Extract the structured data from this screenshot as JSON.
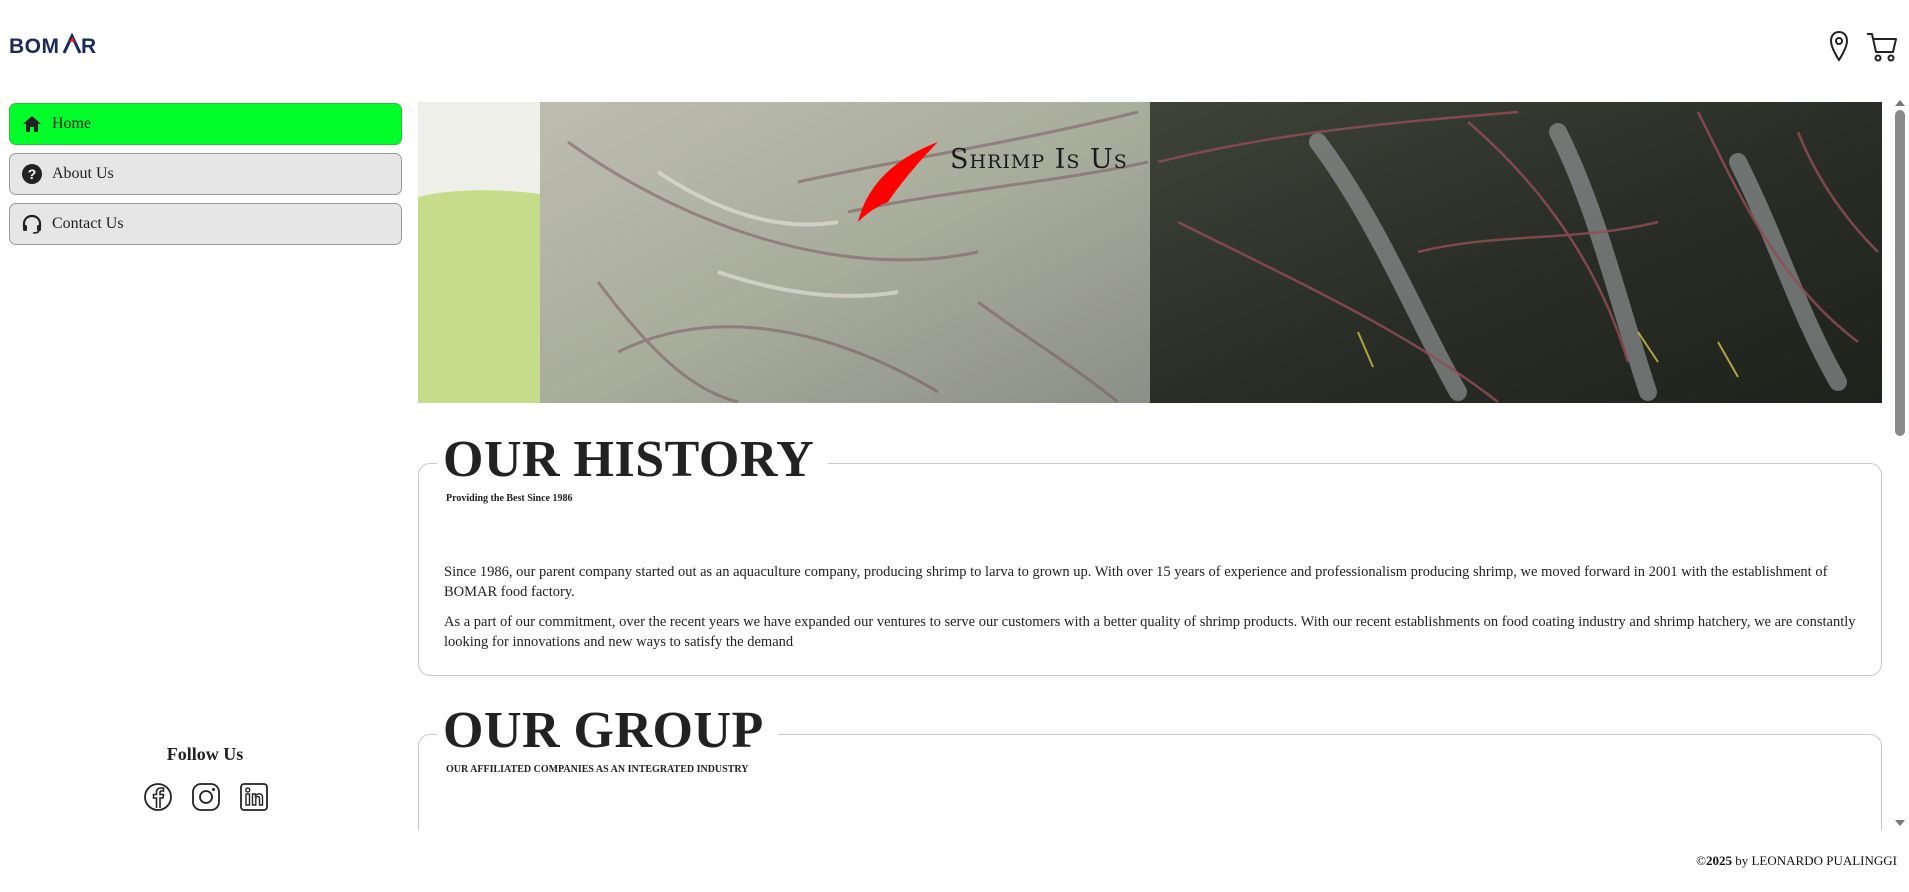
{
  "header": {
    "logo_text": "BOMAR",
    "location_icon": "map-pin-icon",
    "cart_icon": "shopping-cart-icon"
  },
  "sidebar": {
    "items": [
      {
        "label": "Home",
        "icon": "home-icon",
        "active": true
      },
      {
        "label": "About Us",
        "icon": "question-circle-icon",
        "active": false
      },
      {
        "label": "Contact Us",
        "icon": "headset-icon",
        "active": false
      }
    ],
    "follow_title": "Follow Us",
    "social": [
      "facebook-icon",
      "instagram-icon",
      "linkedin-icon"
    ]
  },
  "hero": {
    "title": "Shrimp Is Us"
  },
  "history": {
    "title": "OUR HISTORY",
    "subtitle": "Providing the Best Since 1986",
    "paragraphs": [
      "Since 1986, our parent company started out as an aquaculture company, producing shrimp to larva to grown up. With over 15 years of experience and professionalism producing shrimp, we moved forward in 2001 with the establishment of BOMAR food factory.",
      "As a part of our commitment, over the recent years we have expanded our ventures to serve our customers with a better quality of shrimp products. With our recent establishments on food coating industry and shrimp hatchery, we are constantly looking for innovations and new ways to satisfy the demand"
    ]
  },
  "group": {
    "title": "OUR GROUP",
    "subtitle": "OUR AFFILIATED COMPANIES AS AN INTEGRATED INDUSTRY"
  },
  "footer": {
    "year": "2025",
    "text": " by LEONARDO PUALINGGI"
  },
  "colors": {
    "active_nav": "#00ff2a",
    "nav_bg": "#e6e6e6",
    "logo_accent": "#e0262e",
    "logo_text": "#1c2a5a"
  }
}
